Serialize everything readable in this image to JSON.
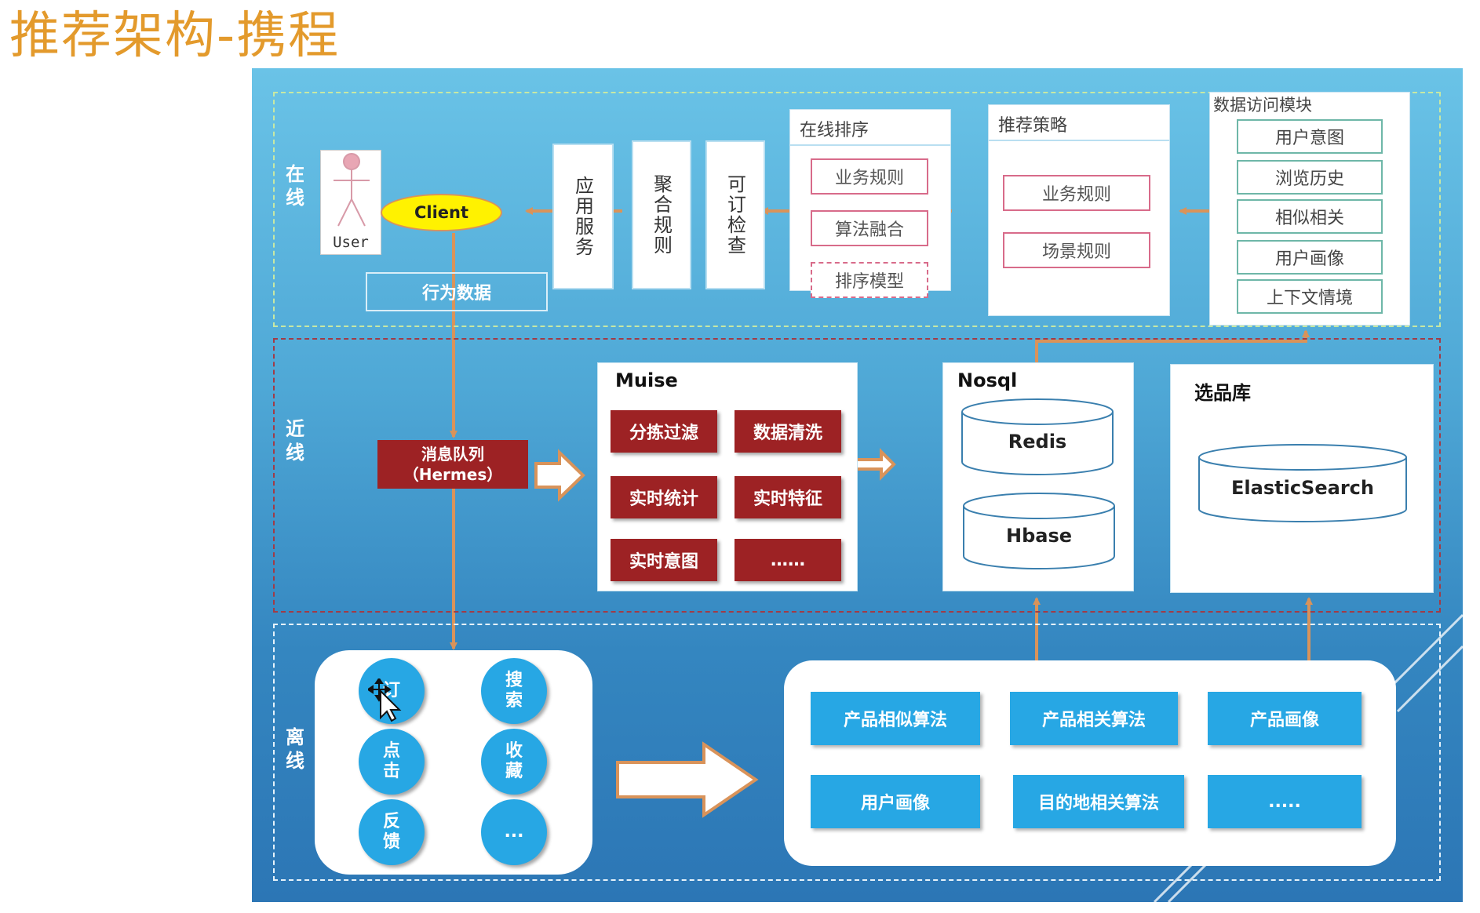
{
  "title": "推荐架构-携程",
  "zones": {
    "online": "在线",
    "nearline": "近线",
    "offline": "离线"
  },
  "online": {
    "user_label": "User",
    "client_label": "Client",
    "behavior_data": "行为数据",
    "app_service": "应用服务",
    "aggregation_rules": "聚合规则",
    "bookable_check": "可订检查",
    "ranking": {
      "title": "在线排序",
      "items": [
        "业务规则",
        "算法融合",
        "排序模型"
      ]
    },
    "strategy": {
      "title": "推荐策略",
      "items": [
        "业务规则",
        "场景规则"
      ]
    },
    "data_access": {
      "title": "数据访问模块",
      "items": [
        "用户意图",
        "浏览历史",
        "相似相关",
        "用户画像",
        "上下文情境"
      ]
    }
  },
  "nearline": {
    "mq_line1": "消息队列",
    "mq_line2": "（Hermes）",
    "muise": {
      "title": "Muise",
      "items": [
        "分拣过滤",
        "数据清洗",
        "实时统计",
        "实时特征",
        "实时意图",
        "……"
      ]
    },
    "nosql": {
      "title": "Nosql",
      "items": [
        "Redis",
        "Hbase"
      ]
    },
    "selection": {
      "title": "选品库",
      "items": [
        "ElasticSearch"
      ]
    }
  },
  "offline": {
    "events": [
      "订",
      "搜索",
      "点击",
      "收藏",
      "反馈",
      "..."
    ],
    "algorithms": [
      "产品相似算法",
      "产品相关算法",
      "产品画像",
      "用户画像",
      "目的地相关算法",
      "....."
    ]
  },
  "colors": {
    "title": "#E39A2C",
    "arrow": "#D9935A",
    "dark_red": "#9D2224",
    "blue_button": "#27A7E4",
    "client_fill": "#FFF200"
  }
}
